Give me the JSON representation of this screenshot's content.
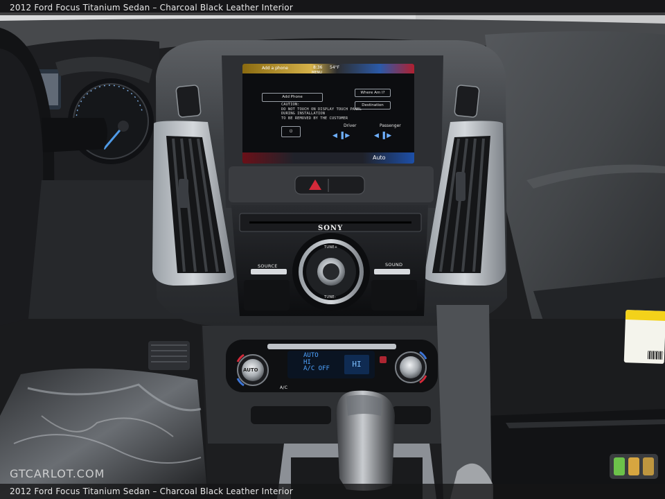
{
  "caption": {
    "title": "2012 Ford Focus Titanium Sedan – Charcoal Black Leather Interior"
  },
  "watermark": {
    "text": "GTCARLOT.COM"
  },
  "infotainment": {
    "tab_phone": "Add a phone",
    "time": "8:36",
    "temp": "54°F",
    "tab_menu": "MENU",
    "add_phone_button": "Add Phone",
    "where_am_i": "Where Am I?",
    "destination": "Destination",
    "caution_lines": [
      "CAUTION:",
      "DO NOT TOUCH ON DISPLAY TOUCH PANEL",
      "DURING INSTALLATION",
      "TO BE REMOVED BY THE CUSTOMER"
    ],
    "driver_label": "Driver",
    "passenger_label": "Passenger",
    "auto_label": "Auto"
  },
  "audio_unit": {
    "brand": "SONY",
    "source_label": "SOURCE",
    "sound_label": "SOUND",
    "tune_plus": "TUNE+",
    "tune_minus": "TUNE-"
  },
  "climate": {
    "auto_knob_label": "AUTO",
    "lcd_lines": [
      "AUTO",
      "HI",
      "A/C OFF"
    ],
    "fan_level": "HI",
    "ac_label": "A/C"
  },
  "colors": {
    "accent_red": "#d42a3a",
    "lcd_blue": "#4fa3ff",
    "sticker_yellow": "#f3d21a"
  }
}
